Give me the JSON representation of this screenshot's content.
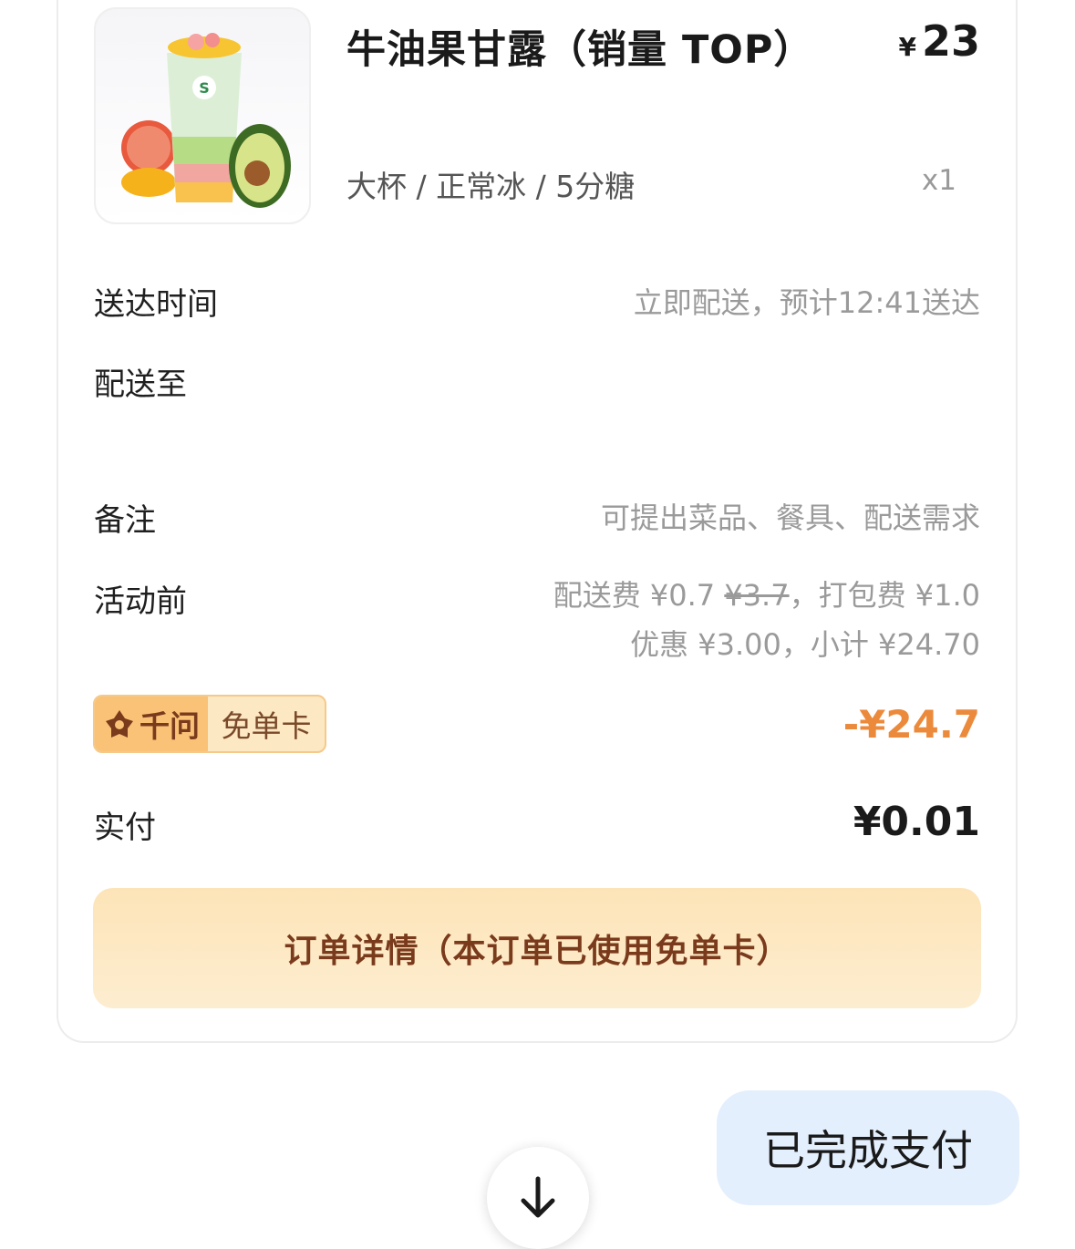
{
  "product": {
    "name": "牛油果甘露（销量 TOP）",
    "price_symbol": "¥",
    "price": "23",
    "spec": "大杯 / 正常冰 / 5分糖",
    "qty": "x1",
    "image_icon": "avocado-drink-image",
    "cup_logo": "S"
  },
  "rows": {
    "delivery_time_label": "送达时间",
    "delivery_time_value": "立即配送，预计12:41送达",
    "deliver_to_label": "配送至",
    "remark_label": "备注",
    "remark_placeholder": "可提出菜品、餐具、配送需求",
    "promo_label": "活动前",
    "promo_line1_prefix": "配送费 ¥0.7 ",
    "promo_line1_strike": "¥3.7",
    "promo_line1_suffix": "，打包费 ¥1.0",
    "promo_line2": "优惠 ¥3.00，小计 ¥24.70"
  },
  "coupon": {
    "brand": "千问",
    "card_name": "免单卡",
    "discount": "-¥24.7"
  },
  "paid": {
    "label": "实付",
    "value": "¥0.01"
  },
  "detail_button": "订单详情（本订单已使用免单卡）",
  "chat_bubble": "已完成支付",
  "colors": {
    "accent_orange": "#ec8a3c",
    "button_bg": "#fde8c4",
    "bubble_bg": "#e4effd"
  }
}
